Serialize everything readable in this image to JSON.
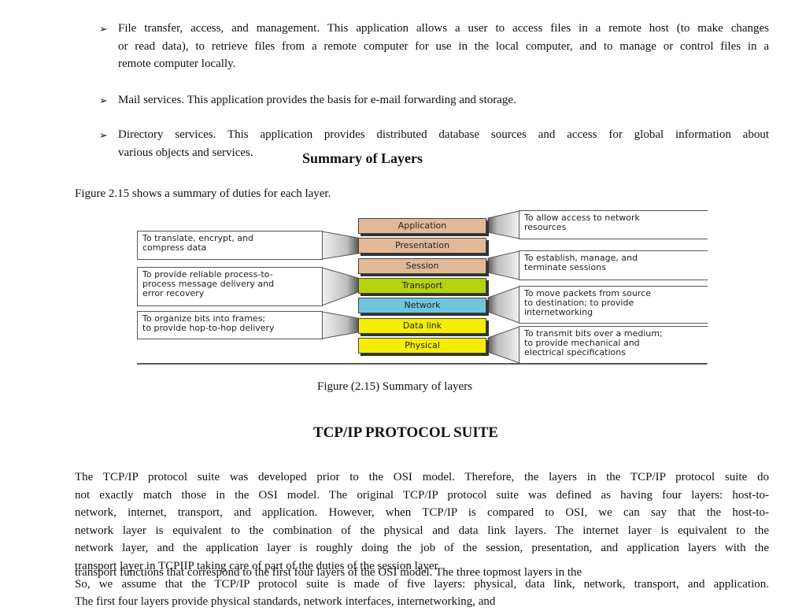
{
  "bullets": [
    {
      "lines": [
        "File transfer, access, and management. This application allows a user to access files in a remote host (to make changes",
        "or read data), to retrieve files from a remote computer for use in the local computer, and to manage or control files in a",
        "remote computer locally."
      ]
    },
    {
      "lines": [
        "Mail services. This application provides the basis for e-mail forwarding and storage."
      ]
    },
    {
      "lines": [
        "Directory services. This application provides distributed database sources and access for global information about",
        "various objects and services."
      ]
    }
  ],
  "bullet_glyph": "➢",
  "section_heading": "Summary of Layers",
  "figure_intro": "Figure 2.15 shows a summary of duties for each layer.",
  "figure": {
    "layers": [
      {
        "name": "Application",
        "color": "#e2b998"
      },
      {
        "name": "Presentation",
        "color": "#e2b998"
      },
      {
        "name": "Session",
        "color": "#e2b998"
      },
      {
        "name": "Transport",
        "color": "#b5d40e"
      },
      {
        "name": "Network",
        "color": "#6ec6dc"
      },
      {
        "name": "Data link",
        "color": "#f4ee05"
      },
      {
        "name": "Physical",
        "color": "#f4ee05"
      }
    ],
    "left_descriptions": [
      {
        "layer": "Presentation",
        "lines": [
          "To translate, encrypt, and",
          "compress data"
        ]
      },
      {
        "layer": "Transport",
        "lines": [
          "To provide reliable process-to-",
          "process message delivery and",
          "error recovery"
        ]
      },
      {
        "layer": "Data link",
        "lines": [
          "To organize bits into frames;",
          "to provide hop-to-hop delivery"
        ]
      }
    ],
    "right_descriptions": [
      {
        "layer": "Application",
        "lines": [
          "To allow access to network",
          "resources"
        ]
      },
      {
        "layer": "Session",
        "lines": [
          "To establish, manage, and",
          "terminate sessions"
        ]
      },
      {
        "layer": "Network",
        "lines": [
          "To move packets from source",
          "to destination; to provide",
          "internetworking"
        ]
      },
      {
        "layer": "Physical",
        "lines": [
          "To transmit bits over a medium;",
          "to provide mechanical and",
          "electrical specifications"
        ]
      }
    ],
    "caption": "Figure (2.15) Summary of layers"
  },
  "tcpip_heading": "TCP/IP PROTOCOL SUITE",
  "tcpip_paragraph_lines": [
    "The TCP/IP protocol suite was developed prior to the OSI model. Therefore, the layers in the TCP/IP protocol suite do",
    "not exactly match those in the OSI model. The original TCP/IP protocol suite was defined as having four layers: host-to-",
    "network, internet, transport, and application. However, when TCP/IP is compared to OSI, we can say that the host-to-",
    "network layer is equivalent to the combination of the physical and data link layers. The internet layer is equivalent to the",
    "network layer, and the application layer is roughly doing the job of the session, presentation, and application layers with the"
  ],
  "overlap_line_a": "transport layer in TCPIIP taking care of part of the duties of the session layer.",
  "overlap_line_b": "transport functions that correspond to the first four layers of the OSI model. The three topmost layers in the",
  "five_layer_line": "So, we assume that the TCP/IP protocol suite is made of five layers: physical, data link, network, transport, and application.",
  "last_line": "The first four layers provide physical standards, network interfaces, internetworking, and"
}
